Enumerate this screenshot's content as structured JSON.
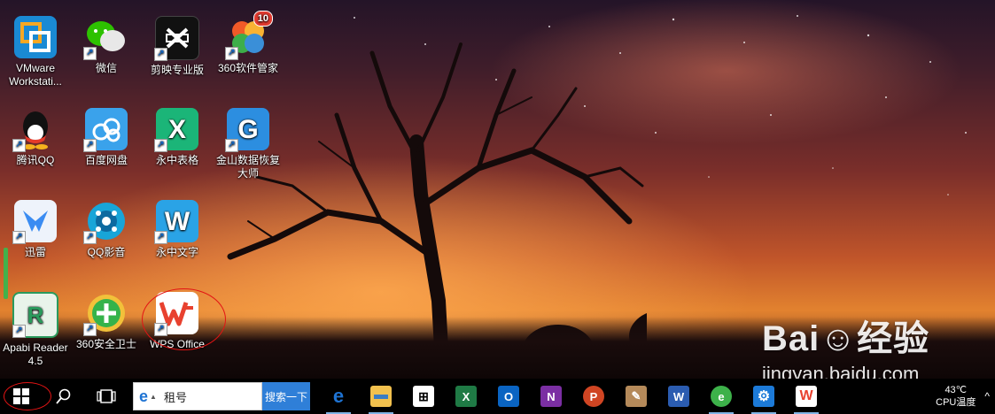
{
  "desktop": {
    "icons": [
      {
        "label": "VMware Workstati...",
        "icon": "vmware-icon",
        "color": "#1a8ad4"
      },
      {
        "label": "微信",
        "icon": "wechat-icon",
        "color": "#2dc100"
      },
      {
        "label": "剪映专业版",
        "icon": "capcut-icon",
        "color": "#111111"
      },
      {
        "label": "360软件管家",
        "icon": "360-software-manager-icon",
        "color": "#f05a28",
        "badge": "10"
      },
      {
        "label": "腾讯QQ",
        "icon": "qq-icon",
        "color": "#111111"
      },
      {
        "label": "百度网盘",
        "icon": "baidu-netdisk-icon",
        "color": "#3aa2eb"
      },
      {
        "label": "永中表格",
        "icon": "yozo-sheet-icon",
        "color": "#1bb578"
      },
      {
        "label": "金山数据恢复大师",
        "icon": "kingsoft-data-recovery-icon",
        "color": "#2c8ee0"
      },
      {
        "label": "迅雷",
        "icon": "thunder-icon",
        "color": "#3b8cf2"
      },
      {
        "label": "QQ影音",
        "icon": "qq-player-icon",
        "color": "#18a5d8"
      },
      {
        "label": "永中文字",
        "icon": "yozo-writer-icon",
        "color": "#2aa3e6"
      },
      {
        "label": "Apabi Reader 4.5",
        "icon": "apabi-reader-icon",
        "color": "#2a9a5c"
      },
      {
        "label": "360安全卫士",
        "icon": "360-safe-icon",
        "color": "#35b34a"
      },
      {
        "label": "WPS Office",
        "icon": "wps-icon",
        "color": "#e8412f"
      }
    ],
    "watermark": {
      "brand": "Bai☺经验",
      "url": "jingyan.baidu.com"
    }
  },
  "taskbar": {
    "start_icon": "windows-start-icon",
    "search": {
      "value": "租号",
      "button": "搜索一下"
    },
    "apps": [
      {
        "name": "edge",
        "icon": "edge-icon",
        "glyph": "e",
        "color": "#1e73d3"
      },
      {
        "name": "explorer",
        "icon": "file-explorer-icon",
        "glyph": "▬",
        "color": "#f2c14e"
      },
      {
        "name": "store",
        "icon": "store-icon",
        "glyph": "⊞",
        "color": "#ffffff"
      },
      {
        "name": "excel",
        "icon": "excel-icon",
        "glyph": "X",
        "color": "#1f7a45"
      },
      {
        "name": "outlook",
        "icon": "outlook-icon",
        "glyph": "O",
        "color": "#0a64c2"
      },
      {
        "name": "onenote",
        "icon": "onenote-icon",
        "glyph": "N",
        "color": "#7b2fa3"
      },
      {
        "name": "powerpoint",
        "icon": "powerpoint-icon",
        "glyph": "P",
        "color": "#d04523"
      },
      {
        "name": "paint",
        "icon": "paint-icon",
        "glyph": "✎",
        "color": "#b58a5a"
      },
      {
        "name": "word",
        "icon": "word-icon",
        "glyph": "W",
        "color": "#2b5cb0"
      },
      {
        "name": "360browser",
        "icon": "360-browser-icon",
        "glyph": "e",
        "color": "#3db14a"
      },
      {
        "name": "settings",
        "icon": "settings-icon",
        "glyph": "⚙",
        "color": "#1c7ad8"
      },
      {
        "name": "wps",
        "icon": "wps-taskbar-icon",
        "glyph": "W",
        "color": "#e8412f"
      }
    ],
    "tray": {
      "temp": "43℃",
      "label": "CPU温度",
      "chevron": "^"
    }
  }
}
